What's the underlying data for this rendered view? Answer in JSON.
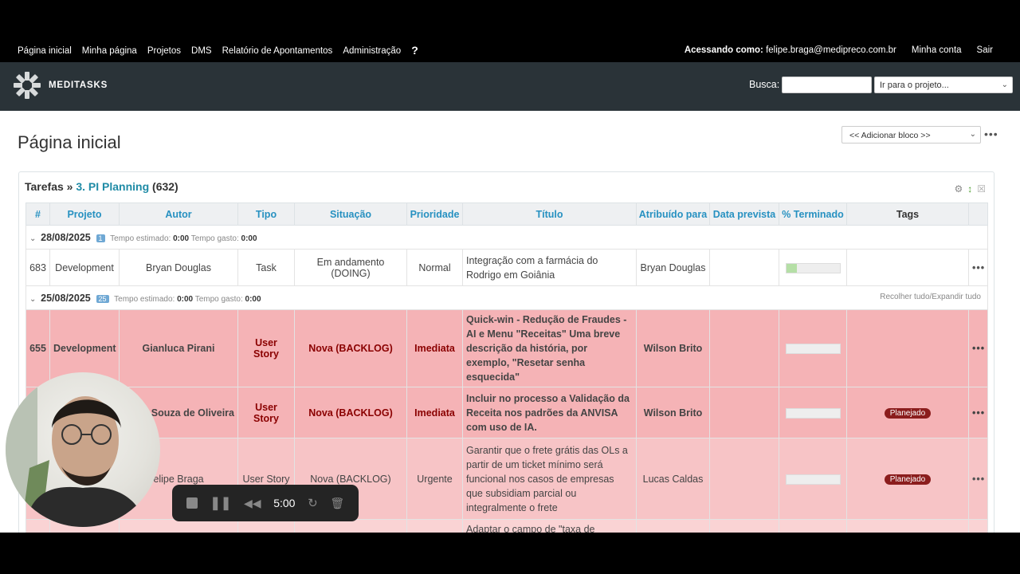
{
  "topmenu": {
    "items": [
      "Página inicial",
      "Minha página",
      "Projetos",
      "DMS",
      "Relatório de Apontamentos",
      "Administração"
    ],
    "help": "?",
    "logged_label": "Acessando como:",
    "logged_user": "felipe.braga@medipreco.com.br",
    "my_account": "Minha conta",
    "logout": "Sair"
  },
  "header": {
    "brand": "MEDITASKS",
    "search_label": "Busca:",
    "project_select": "Ir para o projeto..."
  },
  "main": {
    "title": "Página inicial",
    "add_block": "<< Adicionar bloco >>",
    "menu": "•••"
  },
  "query": {
    "prefix": "Tarefas »",
    "name": "3. PI Planning",
    "count": "(632)"
  },
  "columns": [
    "#",
    "Projeto",
    "Autor",
    "Tipo",
    "Situação",
    "Prioridade",
    "Título",
    "Atribuído para",
    "Data prevista",
    "% Terminado",
    "Tags"
  ],
  "groups": [
    {
      "date": "28/08/2025",
      "count": "1",
      "est_label": "Tempo estimado:",
      "est": "0:00",
      "spent_label": "Tempo gasto:",
      "spent": "0:00"
    },
    {
      "date": "25/08/2025",
      "count": "25",
      "est_label": "Tempo estimado:",
      "est": "0:00",
      "spent_label": "Tempo gasto:",
      "spent": "0:00",
      "collapse": "Recolher tudo/Expandir tudo"
    }
  ],
  "rows": [
    {
      "id": "683",
      "project": "Development",
      "author": "Bryan Douglas",
      "type": "Task",
      "status": "Em andamento (DOING)",
      "priority": "Normal",
      "title": "Integração com a farmácia do Rodrigo em Goiânia",
      "assignee": "Bryan Douglas",
      "due": "",
      "done": 0.2,
      "tag": ""
    },
    {
      "id": "655",
      "project": "Development",
      "author": "Gianluca Pirani",
      "type": "User Story",
      "status": "Nova (BACKLOG)",
      "priority": "Imediata",
      "title": "Quick-win - Redução de Fraudes - AI e Menu \"Receitas\" Uma breve descrição da história, por exemplo, \"Resetar senha esquecida\"",
      "assignee": "Wilson Brito",
      "due": "",
      "done": 0,
      "tag": ""
    },
    {
      "id": "",
      "project": "",
      "author": "mo Souza de Oliveira",
      "type": "User Story",
      "status": "Nova (BACKLOG)",
      "priority": "Imediata",
      "title": "Incluir no processo a Validação da Receita nos padrões da ANVISA com uso de IA.",
      "assignee": "Wilson Brito",
      "due": "",
      "done": 0,
      "tag": "Planejado"
    },
    {
      "id": "",
      "project": "",
      "author": "elipe Braga",
      "type": "User Story",
      "status": "Nova (BACKLOG)",
      "priority": "Urgente",
      "title": "Garantir que o frete grátis das OLs a partir de um ticket mínimo será funcional nos casos de empresas que subsidiam parcial ou integralmente o frete",
      "assignee": "Lucas Caldas",
      "due": "",
      "done": 0,
      "tag": "Planejado"
    },
    {
      "id": "",
      "project": "",
      "author": "",
      "type": "",
      "status": "",
      "priority": "",
      "title": "Adaptar o campo de \"taxa de empresa subsidiada pela empresa\"",
      "assignee": "",
      "due": "",
      "done": 0,
      "tag": ""
    }
  ],
  "recorder": {
    "timer": "5:00"
  }
}
